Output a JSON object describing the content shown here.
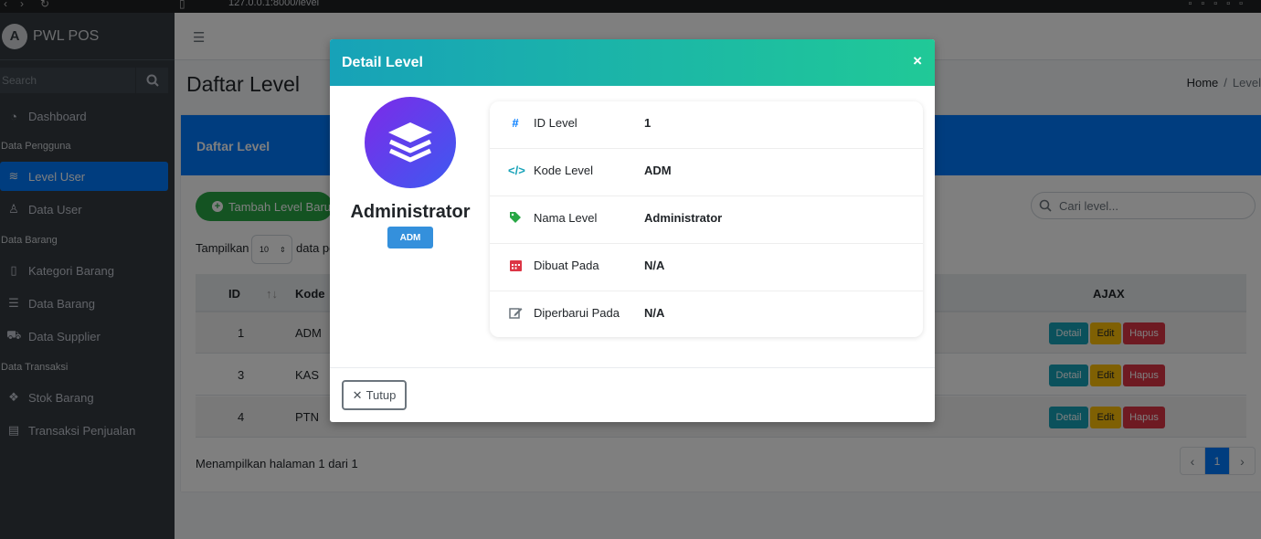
{
  "browser": {
    "url": "127.0.0.1:8000/level"
  },
  "brand": {
    "logo_letter": "A",
    "name": "PWL POS"
  },
  "sidebar": {
    "search_placeholder": "Search",
    "items": [
      {
        "label": "Dashboard",
        "icon": "dashboard-icon"
      },
      {
        "header": "Data Pengguna"
      },
      {
        "label": "Level User",
        "icon": "layers-icon",
        "active": true
      },
      {
        "label": "Data User",
        "icon": "user-icon"
      },
      {
        "header": "Data Barang"
      },
      {
        "label": "Kategori Barang",
        "icon": "bookmark-icon"
      },
      {
        "label": "Data Barang",
        "icon": "list-icon"
      },
      {
        "label": "Data Supplier",
        "icon": "truck-icon"
      },
      {
        "header": "Data Transaksi"
      },
      {
        "label": "Stok Barang",
        "icon": "cubes-icon"
      },
      {
        "label": "Transaksi Penjualan",
        "icon": "cash-register-icon"
      }
    ]
  },
  "page": {
    "title": "Daftar Level",
    "breadcrumb": {
      "home": "Home",
      "sep": "/",
      "current": "Level"
    }
  },
  "card": {
    "header": "Daftar Level",
    "add_button": "Tambah Level Baru",
    "search_placeholder": "Cari level...",
    "show_label": "Tampilkan",
    "page_size": "10",
    "show_label_after": "data per halaman",
    "columns": {
      "id": "ID",
      "kode": "Kode",
      "ajax": "AJAX"
    },
    "rows": [
      {
        "id": "1",
        "kode": "ADM"
      },
      {
        "id": "3",
        "kode": "KAS"
      },
      {
        "id": "4",
        "kode": "PTN"
      }
    ],
    "actions": {
      "detail": "Detail",
      "edit": "Edit",
      "hapus": "Hapus"
    },
    "footer": "Menampilkan halaman 1 dari 1",
    "pagination": {
      "prev": "‹",
      "current": "1",
      "next": "›"
    }
  },
  "modal": {
    "title": "Detail Level",
    "close_symbol": "×",
    "level_name": "Administrator",
    "level_badge": "ADM",
    "fields": [
      {
        "icon": "hash-icon",
        "label": "ID Level",
        "value": "1"
      },
      {
        "icon": "code-icon",
        "label": "Kode Level",
        "value": "ADM"
      },
      {
        "icon": "tag-icon",
        "label": "Nama Level",
        "value": "Administrator"
      },
      {
        "icon": "calendar-icon",
        "label": "Dibuat Pada",
        "value": "N/A"
      },
      {
        "icon": "edit-icon",
        "label": "Diperbarui Pada",
        "value": "N/A"
      }
    ],
    "close_button": "Tutup"
  },
  "colors": {
    "primary": "#007bff",
    "success": "#28a745",
    "info": "#17a2b8",
    "warning": "#ffc107",
    "danger": "#dc3545",
    "sidebar": "#343a40"
  }
}
